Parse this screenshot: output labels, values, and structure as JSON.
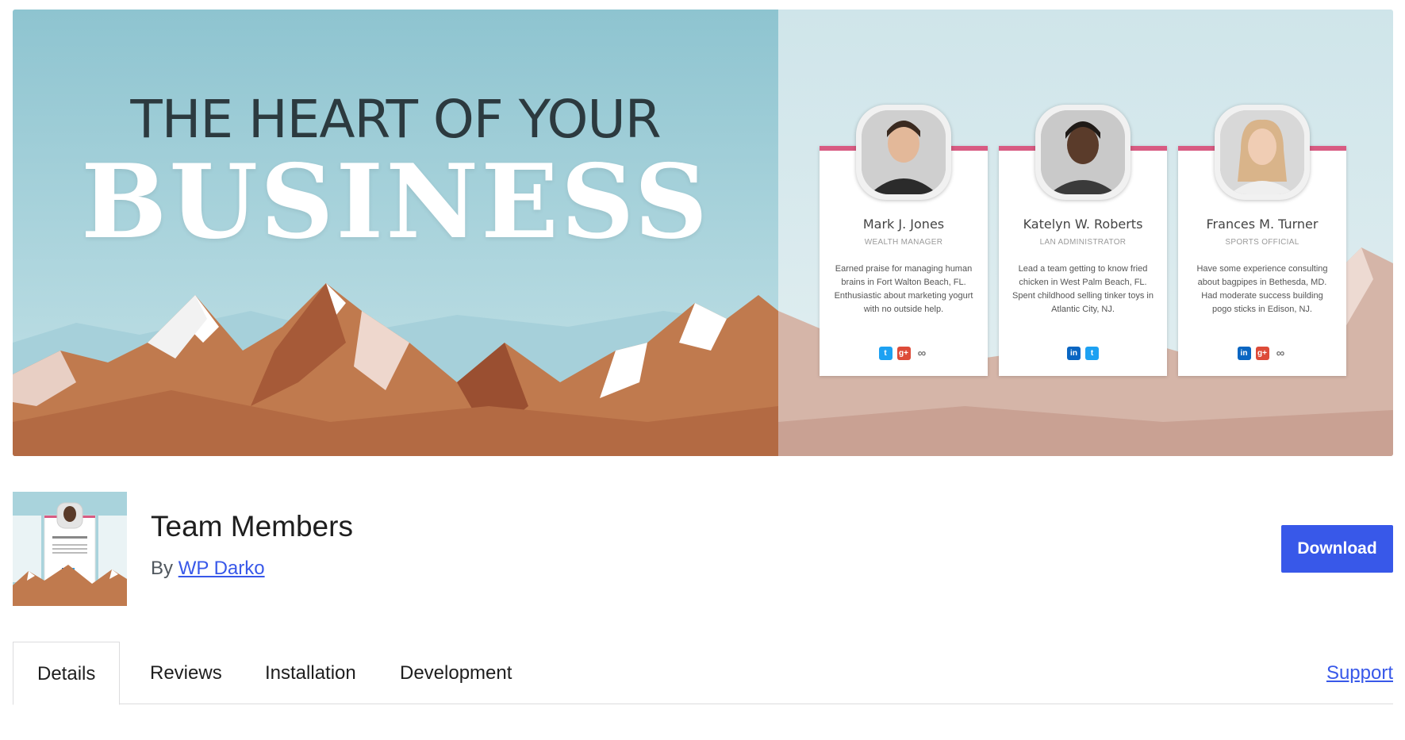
{
  "banner": {
    "headline_top": "THE HEART OF YOUR",
    "headline_big": "BUSINESS",
    "cards": [
      {
        "name": "Mark J. Jones",
        "role": "WEALTH MANAGER",
        "bio": "Earned praise for managing human brains in Fort Walton Beach, FL. Enthusiastic about marketing yogurt with no outside help.",
        "social": [
          "twitter-icon",
          "google-plus-icon",
          "link-icon"
        ]
      },
      {
        "name": "Katelyn  W. Roberts",
        "role": "LAN ADMINISTRATOR",
        "bio": "Lead a team getting to know fried chicken in West Palm Beach, FL. Spent childhood selling tinker toys in Atlantic City, NJ.",
        "social": [
          "linkedin-icon",
          "twitter-icon"
        ]
      },
      {
        "name": "Frances M.  Turner",
        "role": "SPORTS OFFICIAL",
        "bio": "Have some experience consulting about bagpipes in Bethesda, MD. Had moderate success building pogo sticks in Edison, NJ.",
        "social": [
          "linkedin-icon",
          "google-plus-icon",
          "link-icon"
        ]
      }
    ]
  },
  "plugin": {
    "title": "Team Members",
    "by_label": "By",
    "author": "WP Darko",
    "download_label": "Download"
  },
  "tabs": {
    "items": [
      "Details",
      "Reviews",
      "Installation",
      "Development"
    ],
    "active": "Details",
    "support_label": "Support"
  },
  "colors": {
    "accent": "#3858e9",
    "card_strip": "#d85b82",
    "sky": "#9ccbd5"
  }
}
